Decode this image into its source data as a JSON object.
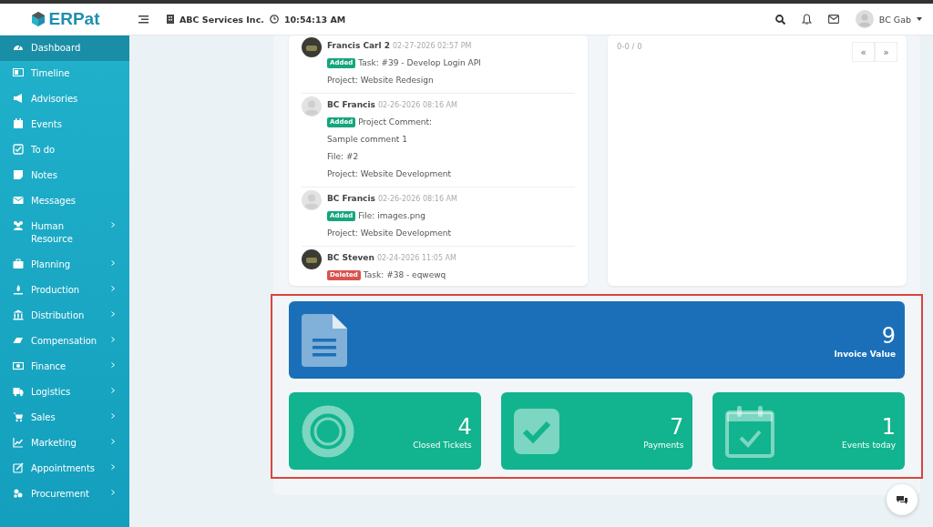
{
  "header": {
    "logo": "ERPat",
    "company": "ABC Services Inc.",
    "time": "10:54:13 AM",
    "user": "BC Gab"
  },
  "sidebar": {
    "items": [
      {
        "label": "Dashboard",
        "selected": true,
        "expandable": false
      },
      {
        "label": "Timeline",
        "selected": false,
        "expandable": false
      },
      {
        "label": "Advisories",
        "selected": false,
        "expandable": false
      },
      {
        "label": "Events",
        "selected": false,
        "expandable": false
      },
      {
        "label": "To do",
        "selected": false,
        "expandable": false
      },
      {
        "label": "Notes",
        "selected": false,
        "expandable": false
      },
      {
        "label": "Messages",
        "selected": false,
        "expandable": false
      },
      {
        "label": "Human Resource",
        "selected": false,
        "expandable": true
      },
      {
        "label": "Planning",
        "selected": false,
        "expandable": true
      },
      {
        "label": "Production",
        "selected": false,
        "expandable": true
      },
      {
        "label": "Distribution",
        "selected": false,
        "expandable": true
      },
      {
        "label": "Compensation",
        "selected": false,
        "expandable": true
      },
      {
        "label": "Finance",
        "selected": false,
        "expandable": true
      },
      {
        "label": "Logistics",
        "selected": false,
        "expandable": true
      },
      {
        "label": "Sales",
        "selected": false,
        "expandable": true
      },
      {
        "label": "Marketing",
        "selected": false,
        "expandable": true
      },
      {
        "label": "Appointments",
        "selected": false,
        "expandable": true
      },
      {
        "label": "Procurement",
        "selected": false,
        "expandable": true
      }
    ]
  },
  "activity": [
    {
      "author": "Francis Carl 2",
      "time": "02-27-2026 02:57 PM",
      "kind": "photo",
      "badge": {
        "label": "Added",
        "kind": "added"
      },
      "text": "Task: #39 - Develop Login API",
      "details": [
        "Project: Website Redesign"
      ]
    },
    {
      "author": "BC Francis",
      "time": "02-26-2026 08:16 AM",
      "kind": "default",
      "badge": {
        "label": "Added",
        "kind": "added"
      },
      "text": "Project Comment:",
      "details": [
        "Sample comment 1",
        "File: #2",
        "Project: Website Development"
      ]
    },
    {
      "author": "BC Francis",
      "time": "02-26-2026 08:16 AM",
      "kind": "default",
      "badge": {
        "label": "Added",
        "kind": "added"
      },
      "text": "File: images.png",
      "details": [
        "Project: Website Development"
      ]
    },
    {
      "author": "BC Steven",
      "time": "02-24-2026 11:05 AM",
      "kind": "photo",
      "badge": {
        "label": "Deleted",
        "kind": "deleted"
      },
      "text": "Task: #38 - eqwewq"
    }
  ],
  "pager": {
    "summary": "0-0 / 0",
    "buttons": [
      "«",
      "»"
    ]
  },
  "stats": [
    {
      "value": "9",
      "label": "Invoice Value",
      "color": "#1b6fb8",
      "kind": "wide"
    },
    {
      "value": "4",
      "label": "Closed Tickets",
      "color": "#11b48e",
      "kind": "small"
    },
    {
      "value": "7",
      "label": "Payments",
      "color": "#11b48e",
      "kind": "small"
    },
    {
      "value": "1",
      "label": "Events today",
      "color": "#11b48e",
      "kind": "small"
    }
  ]
}
